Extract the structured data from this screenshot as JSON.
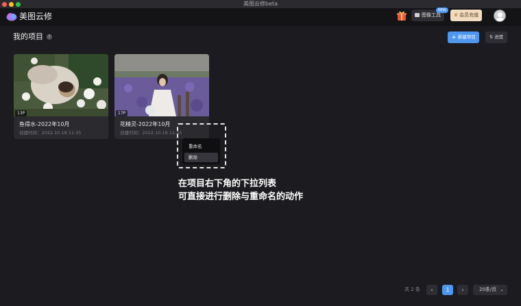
{
  "window": {
    "title": "美图云修beta"
  },
  "header": {
    "app_name": "美图云修",
    "image_tool_label": "图像工具",
    "new_badge": "NEW",
    "vip_label": "会员充值"
  },
  "page": {
    "title": "我的项目",
    "help_symbol": "?",
    "new_project_label": "新建项目",
    "sort_label": "进度"
  },
  "projects": [
    {
      "name": "鱼得水-2022年10月",
      "created": "创建时间：2022.10.18 11:35",
      "count": "13P"
    },
    {
      "name": "花精灵-2022年10月",
      "created": "创建时间：2022.10.18 11:35",
      "count": "17P"
    }
  ],
  "context_menu": {
    "items": [
      "重命名",
      "删除"
    ]
  },
  "annotation": {
    "line1": "在项目右下角的下拉列表",
    "line2": "可直接进行删除与重命名的动作"
  },
  "pagination": {
    "total": "共 2 条",
    "prev_symbol": "‹",
    "current": "1",
    "next_symbol": "›",
    "per_page": "20条/页"
  },
  "colors": {
    "background": "#1c1c20",
    "accent": "#4e97f0",
    "vip": "#f1dcc1"
  },
  "icons": [
    "logo-icon",
    "gift-icon",
    "image-tool-icon",
    "crown-icon",
    "avatar-icon",
    "help-icon",
    "plus-icon",
    "sort-icon",
    "chevron-left-icon",
    "chevron-right-icon",
    "chevron-down-icon"
  ]
}
